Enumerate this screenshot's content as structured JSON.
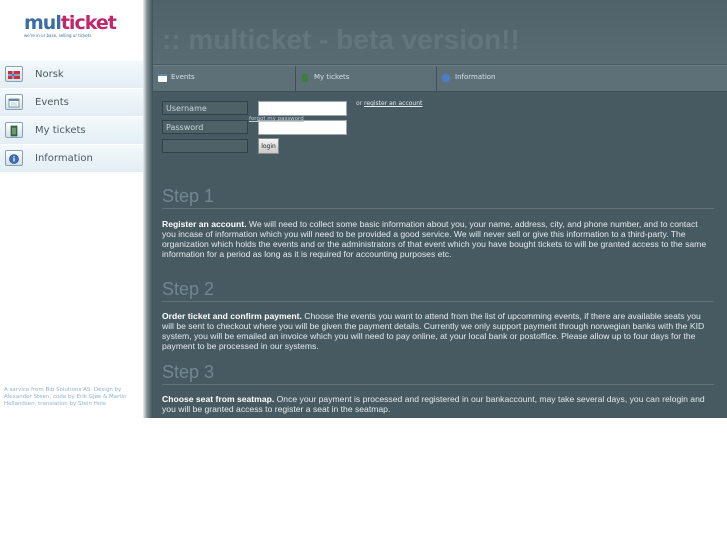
{
  "logo": {
    "brand_main": "mul",
    "brand_accent": "ticket",
    "tagline": "we're in ur base, selling ur tickets"
  },
  "nav": [
    {
      "label": "Norsk",
      "icon": "norway-flag-icon"
    },
    {
      "label": "Events",
      "icon": "calendar-icon"
    },
    {
      "label": "My tickets",
      "icon": "ticket-icon"
    },
    {
      "label": "Information",
      "icon": "info-icon"
    }
  ],
  "credits": "A service from Bib Solutions AS. Design by Alexander Steen, code by Erik Gjøe & Martin Hellandsen, translation by Stein Hole",
  "banner": {
    "title": ":: multicket - beta version!!"
  },
  "tabs": [
    {
      "label": "Events",
      "icon": "calendar-icon"
    },
    {
      "label": "My tickets",
      "icon": "ticket-icon"
    },
    {
      "label": "Information",
      "icon": "info-icon"
    }
  ],
  "login": {
    "username_label": "Username",
    "password_label": "Password",
    "forgot": "forgot my password",
    "or_text": "or ",
    "register_link": "register an account",
    "login_button": "login"
  },
  "steps": [
    {
      "heading": "Step 1",
      "lead": "Register an account.",
      "body": " We will need to collect some basic information about you, your name, address, city, and phone number, and to contact you incase of information which you will need to be provided a good service. We will never sell or give this information to a third-party. The organization which holds the events and or the administrators of that event which you have bought tickets to will be granted access to the same information for a period as long as it is required for accounting purposes etc."
    },
    {
      "heading": "Step 2",
      "lead": "Order ticket and confirm payment.",
      "body": " Choose the events you want to attend from the list of upcomming events, if there are available seats you will be sent to checkout where you will be given the payment details. Currently we only support payment through norwegian banks with the KID system, you will be emailed an invoice which you will need to pay online, at your local bank or postoffice. Please allow up to four days for the payment to be processed in our systems."
    },
    {
      "heading": "Step 3",
      "lead": "Choose seat from seatmap.",
      "body": " Once your payment is processed and registered in our bankaccount, may take several days, you can relogin and you will be granted access to register a seat in the seatmap."
    }
  ],
  "colors": {
    "main_bg": "#475a61",
    "accent_brand": "#c0266b",
    "brand_blue": "#3a6ea5"
  }
}
